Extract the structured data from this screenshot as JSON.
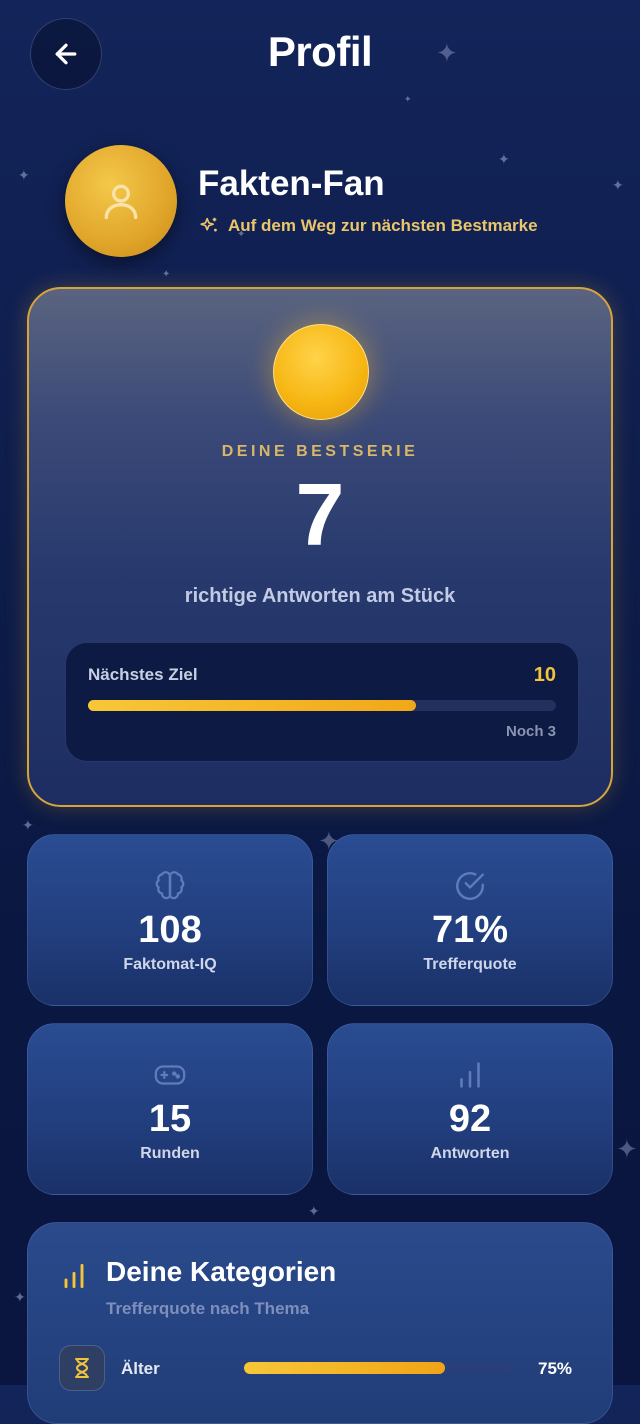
{
  "header": {
    "title": "Profil",
    "back_icon": "arrow-left-icon"
  },
  "profile": {
    "name": "Fakten-Fan",
    "subtitle": "Auf dem Weg zur nächsten Bestmarke",
    "avatar_icon": "user-icon",
    "subtitle_icon": "sparkles-icon"
  },
  "streak": {
    "label": "DEINE BESTSERIE",
    "value": "7",
    "description": "richtige Antworten am Stück",
    "goal": {
      "label": "Nächstes Ziel",
      "value": "10",
      "progress": 0.7,
      "remaining": "Noch 3"
    }
  },
  "stats": [
    {
      "icon": "brain-icon",
      "value": "108",
      "label": "Faktomat-IQ"
    },
    {
      "icon": "check-circle-icon",
      "value": "71%",
      "label": "Trefferquote"
    },
    {
      "icon": "gamepad-icon",
      "value": "15",
      "label": "Runden"
    },
    {
      "icon": "bar-chart-icon",
      "value": "92",
      "label": "Antworten"
    }
  ],
  "categories": {
    "title": "Deine Kategorien",
    "subtitle": "Trefferquote nach Thema",
    "icon": "bar-chart-icon",
    "items": [
      {
        "icon": "hourglass-icon",
        "name": "Älter",
        "percent_label": "75%",
        "progress": 0.75
      }
    ]
  },
  "colors": {
    "accent": "#f2c33c",
    "background": "#0e1d4c",
    "card": "#223f7f"
  }
}
